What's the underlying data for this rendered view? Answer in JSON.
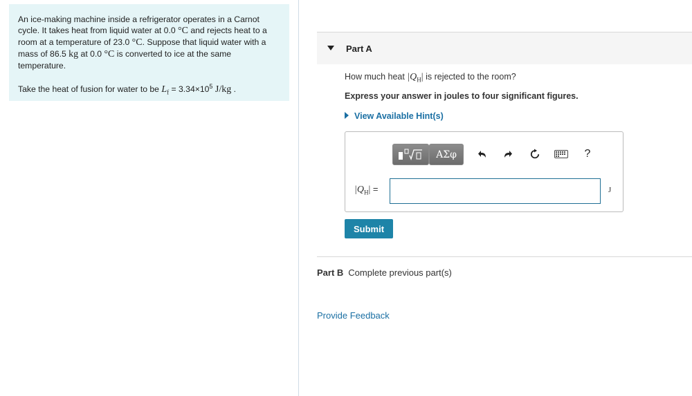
{
  "problem": {
    "statement": {
      "p1": "An ice-making machine inside a refrigerator operates in a Carnot cycle. It takes heat from liquid water at 0.0 ",
      "deg_c1": "°C",
      "p2": " and rejects heat to a room at a temperature of 23.0 ",
      "deg_c2": "°C",
      "p3": ". Suppose that liquid water with a mass of 86.5 ",
      "kg": "kg",
      "p4": " at 0.0 ",
      "deg_c3": "°C",
      "p5": " is converted to ice at the same temperature."
    },
    "given": {
      "prefix": "Take the heat of fusion for water to be ",
      "symbol": "L",
      "subscript": "f",
      "value": " = 3.34×10",
      "exponent": "5",
      "unit": " J/kg",
      "suffix": " ."
    }
  },
  "partA": {
    "title": "Part A",
    "question_pre": "How much heat ",
    "question_sym": "|Q",
    "question_sub": "H",
    "question_close": "|",
    "question_post": " is rejected to the room?",
    "instruction": "Express your answer in joules to four significant figures.",
    "hint_label": "View Available Hint(s)",
    "toolbar": {
      "templates_icon": "template-icon",
      "greek_label": "ΑΣφ",
      "undo_icon": "undo-icon",
      "redo_icon": "redo-icon",
      "reset_icon": "reset-icon",
      "keyboard_icon": "keyboard-icon",
      "help_label": "?"
    },
    "answer": {
      "label_sym": "|Q",
      "label_sub": "H",
      "label_close": "|",
      "equals": " =",
      "value": "",
      "unit": "J"
    },
    "submit_label": "Submit"
  },
  "partB": {
    "title": "Part B",
    "status": "Complete previous part(s)"
  },
  "feedback_label": "Provide Feedback"
}
